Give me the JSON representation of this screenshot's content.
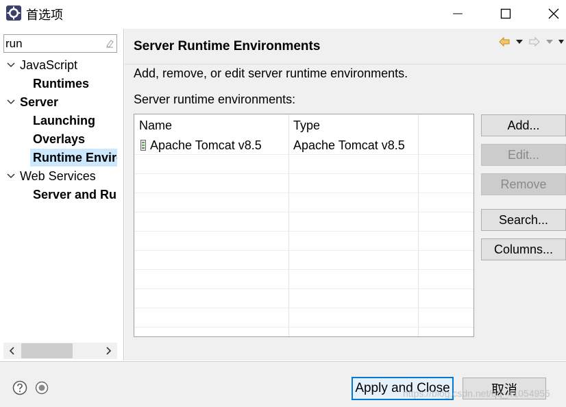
{
  "window": {
    "title": "首选项",
    "minimize_icon": "minimize-icon",
    "maximize_icon": "maximize-icon",
    "close_icon": "close-icon"
  },
  "filter": {
    "value": "run",
    "clear_icon": "clear-filter-icon"
  },
  "tree": {
    "items": [
      {
        "label": "JavaScript",
        "level": 0,
        "expanded": true,
        "bold": false
      },
      {
        "label": "Runtimes",
        "level": 1,
        "bold": true
      },
      {
        "label": "Server",
        "level": 0,
        "expanded": true,
        "bold": true
      },
      {
        "label": "Launching",
        "level": 1,
        "bold": true
      },
      {
        "label": "Overlays",
        "level": 1,
        "bold": true
      },
      {
        "label": "Runtime Environments",
        "level": 1,
        "bold": true,
        "selected": true
      },
      {
        "label": "Web Services",
        "level": 0,
        "expanded": true,
        "bold": false
      },
      {
        "label": "Server and Runtime",
        "level": 1,
        "bold": true
      }
    ]
  },
  "page": {
    "title": "Server Runtime Environments",
    "description": "Add, remove, or edit server runtime environments.",
    "list_label": "Server runtime environments:",
    "nav": {
      "back_icon": "back-arrow-icon",
      "back_menu_icon": "dropdown-triangle-icon",
      "forward_icon": "forward-arrow-icon",
      "forward_menu_icon": "dropdown-triangle-icon",
      "view_menu_icon": "view-menu-icon"
    },
    "table": {
      "columns": [
        "Name",
        "Type"
      ],
      "rows": [
        {
          "name": "Apache Tomcat v8.5",
          "type": "Apache Tomcat v8.5",
          "icon": "server-icon"
        }
      ]
    },
    "buttons": {
      "add": "Add...",
      "edit": "Edit...",
      "remove": "Remove",
      "search": "Search...",
      "columns": "Columns..."
    }
  },
  "bottom": {
    "help_icon": "help-icon",
    "import_export_icon": "import-export-icon",
    "apply_close": "Apply and Close",
    "cancel": "取消",
    "watermark": "https://blog.csdn.net/qq_41054955"
  },
  "colors": {
    "selection": "#cce8ff",
    "default_button_border": "#0078d7",
    "back_arrow": "#e8a33a"
  }
}
